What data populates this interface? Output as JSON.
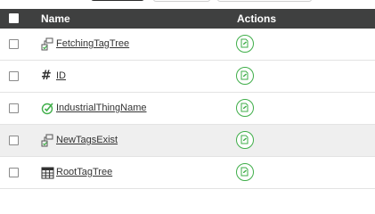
{
  "header": {
    "select_all": "",
    "name_label": "Name",
    "actions_label": "Actions"
  },
  "rows": [
    {
      "name": "FetchingTagTree",
      "icon": "infotable-tree-icon",
      "selected": false
    },
    {
      "name": "ID",
      "icon": "hash-icon",
      "selected": false
    },
    {
      "name": "IndustrialThingName",
      "icon": "thingname-icon",
      "selected": false
    },
    {
      "name": "NewTagsExist",
      "icon": "infotable-tree-icon",
      "selected": true
    },
    {
      "name": "RootTagTree",
      "icon": "table-grid-icon",
      "selected": false
    }
  ],
  "colors": {
    "header_bg": "#3f4040",
    "action_green": "#3fae49",
    "row_selected_bg": "#efefef"
  }
}
